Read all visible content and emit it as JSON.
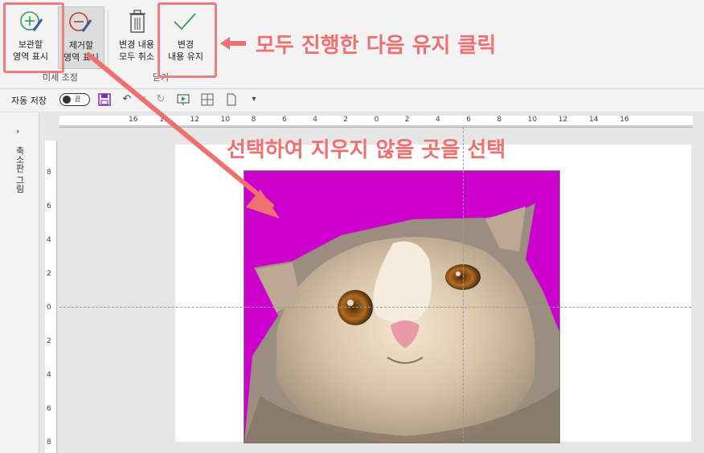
{
  "ribbon": {
    "buttons": {
      "mark_keep": "보관할\n영역 표시",
      "mark_remove": "제거할\n영역 표시",
      "discard_all": "변경 내용\n모두 취소",
      "keep_changes": "변경\n내용 유지"
    },
    "groups": {
      "refine": "미세 조정",
      "close": "닫기"
    }
  },
  "qat": {
    "autosave_label": "자동 저장",
    "autosave_state": "끔"
  },
  "thumbnail_pane": {
    "title": "축소판 그림"
  },
  "rulers": {
    "horizontal": [
      "16",
      "14",
      "12",
      "10",
      "8",
      "6",
      "4",
      "2",
      "0",
      "2",
      "4",
      "6",
      "8",
      "10",
      "12",
      "14",
      "16"
    ],
    "vertical": [
      "8",
      "6",
      "4",
      "2",
      "0",
      "2",
      "4",
      "6",
      "8"
    ]
  },
  "annotations": {
    "top_callout": "모두 진행한 다음 유지 클릭",
    "mid_callout": "선택하여 지우지 않을 곳을 선택",
    "color": "#ee7070"
  },
  "colors": {
    "removal_fill": "#cc00cc",
    "accent_green": "#2e9e58",
    "accent_red": "#c0392b"
  }
}
